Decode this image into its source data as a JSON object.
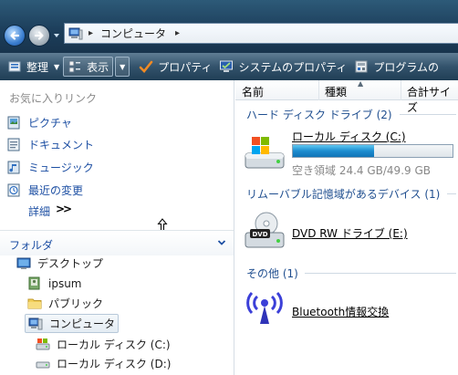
{
  "address": {
    "crumbs": [
      "コンピュータ"
    ]
  },
  "toolbar": {
    "organize_label": "整理",
    "view_label": "表示",
    "properties_label": "プロパティ",
    "system_properties_label": "システムのプロパティ",
    "programs_label": "プログラムの"
  },
  "favorites": {
    "title": "お気に入りリンク",
    "items": [
      {
        "label": "ピクチャ",
        "icon": "pictures-icon"
      },
      {
        "label": "ドキュメント",
        "icon": "documents-icon"
      },
      {
        "label": "ミュージック",
        "icon": "music-icon"
      },
      {
        "label": "最近の変更",
        "icon": "recent-icon"
      }
    ],
    "details_label": "詳細",
    "details_chevron": ">>"
  },
  "folders": {
    "title": "フォルダ",
    "tree": [
      {
        "label": "デスクトップ",
        "icon": "desktop-icon"
      },
      {
        "label": "ipsum",
        "icon": "user-folder-icon"
      },
      {
        "label": "パブリック",
        "icon": "folder-icon"
      },
      {
        "label": "コンピュータ",
        "icon": "computer-icon",
        "selected": true
      },
      {
        "label": "ローカル ディスク (C:)",
        "icon": "hard-drive-icon"
      },
      {
        "label": "ローカル ディスク (D:)",
        "icon": "drive-icon"
      }
    ]
  },
  "columns": {
    "name": "名前",
    "type": "種類",
    "total_size": "合計サイズ"
  },
  "groups": {
    "hdd": {
      "title": "ハード ディスク ドライブ (2)",
      "drive": {
        "name": "ローカル ディスク (C:)",
        "free_text": "空き領域 24.4 GB/49.9 GB",
        "used_fraction": 0.51
      }
    },
    "removable": {
      "title": "リムーバブル記憶域があるデバイス (1)",
      "drive": {
        "name": "DVD RW ドライブ (E:)"
      }
    },
    "other": {
      "title": "その他 (1)",
      "item": {
        "name": "Bluetooth情報交換"
      }
    }
  },
  "colors": {
    "link": "#1d4fa3",
    "group_heading": "#1f4e8f",
    "usage_fill": "#1c8ccf"
  }
}
